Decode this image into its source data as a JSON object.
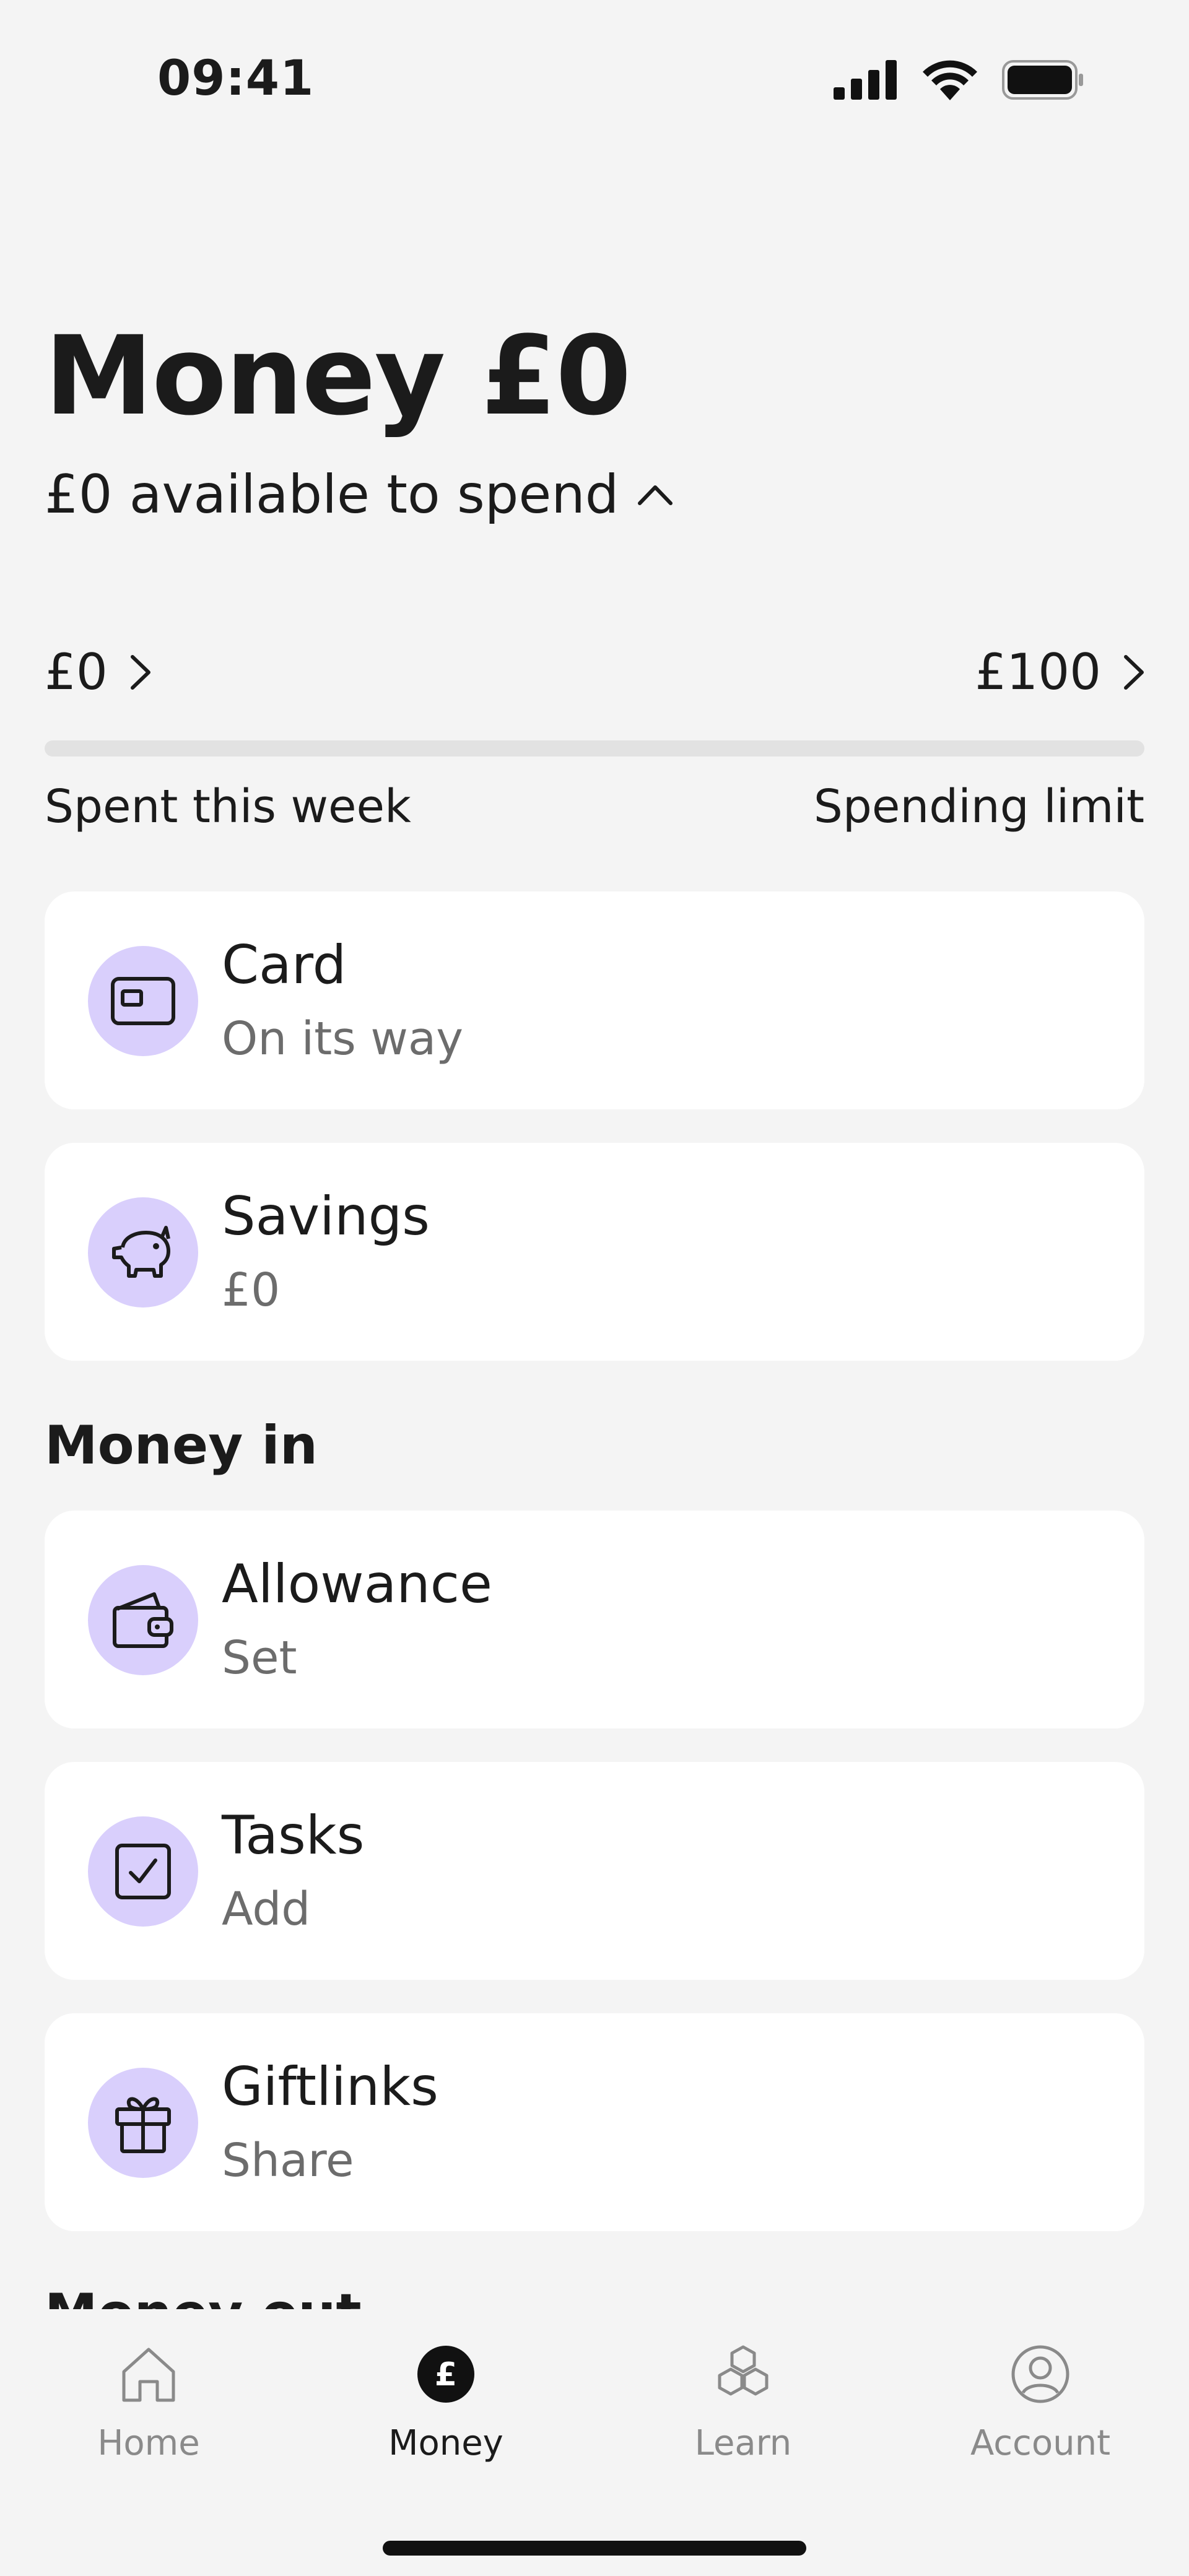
{
  "status_bar": {
    "time": "09:41"
  },
  "header": {
    "title": "Money £0",
    "available_text": "£0 available to spend"
  },
  "spend": {
    "spent_amount": "£0",
    "limit_amount": "£100",
    "spent_label": "Spent this week",
    "limit_label": "Spending limit",
    "progress_fraction": 0
  },
  "cards": [
    {
      "title": "Card",
      "subtitle": "On its way",
      "icon": "card-icon"
    },
    {
      "title": "Savings",
      "subtitle": "£0",
      "icon": "piggy-bank-icon"
    }
  ],
  "money_in": {
    "title": "Money in",
    "items": [
      {
        "title": "Allowance",
        "subtitle": "Set",
        "icon": "wallet-icon"
      },
      {
        "title": "Tasks",
        "subtitle": "Add",
        "icon": "checkbox-icon"
      },
      {
        "title": "Giftlinks",
        "subtitle": "Share",
        "icon": "gift-icon"
      }
    ]
  },
  "money_out": {
    "title": "Money out"
  },
  "nav": {
    "items": [
      {
        "label": "Home",
        "icon": "home-icon",
        "active": false
      },
      {
        "label": "Money",
        "icon": "pound-icon",
        "active": true
      },
      {
        "label": "Learn",
        "icon": "hexagons-icon",
        "active": false
      },
      {
        "label": "Account",
        "icon": "user-icon",
        "active": false
      }
    ]
  },
  "colors": {
    "background": "#f4f4f4",
    "card": "#ffffff",
    "icon_circle": "#d9cffc",
    "muted_text": "#6c6c6c",
    "track": "#e2e2e2"
  }
}
